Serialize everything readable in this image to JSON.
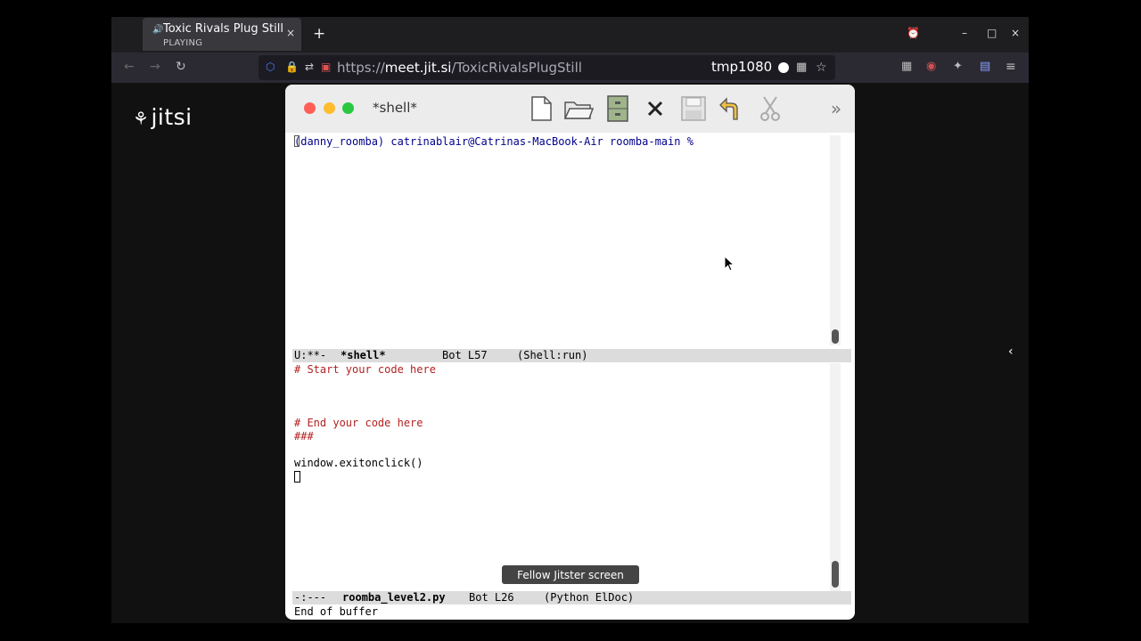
{
  "browser": {
    "tab": {
      "title": "Toxic Rivals Plug Still",
      "subtitle": "PLAYING",
      "close": "×"
    },
    "new_tab": "+",
    "window_controls": {
      "alarm": "⏰",
      "minimize": "–",
      "maximize": "□",
      "close": "×"
    },
    "nav": {
      "back": "←",
      "forward": "→",
      "reload": "↻"
    },
    "url": {
      "prefix": "https://",
      "host": "meet.jit.si",
      "path": "/ToxicRivalsPlugStill"
    },
    "profile": "tmp1080",
    "toolbar_icons": [
      "extensions-icon",
      "vpn-icon",
      "brave-icon",
      "sync-icon",
      "menu-icon"
    ]
  },
  "jitsi": {
    "logo_text": "jitsi",
    "toast": "Fellow Jitster screen",
    "side_toggle": "‹"
  },
  "emacs": {
    "title": "*shell*",
    "toolbar": [
      "new-file-icon",
      "open-folder-icon",
      "file-cabinet-icon",
      "close-x-icon",
      "save-disk-icon",
      "undo-icon",
      "cut-scissors-icon"
    ],
    "more": "»",
    "shell_prompt": "(danny_roomba) catrinablair@Catrinas-MacBook-Air roomba-main %",
    "modeline_top": {
      "state": "U:**-",
      "buffer": "*shell*",
      "position": "Bot L57",
      "mode": "(Shell:run)"
    },
    "code_lines": [
      "# Start your code here",
      "",
      "",
      "# End your code here",
      "###",
      "",
      "window.exitonclick()"
    ],
    "modeline_bottom": {
      "state": "-:---",
      "buffer": "roomba_level2.py",
      "position": "Bot L26",
      "mode": "(Python ElDoc)"
    },
    "echo_area": "End of buffer"
  },
  "colors": {
    "comment": "#b22222",
    "prompt": "#00008b",
    "close_red": "#ff5f57",
    "minimize_yellow": "#febc2e",
    "zoom_green": "#28c840"
  }
}
